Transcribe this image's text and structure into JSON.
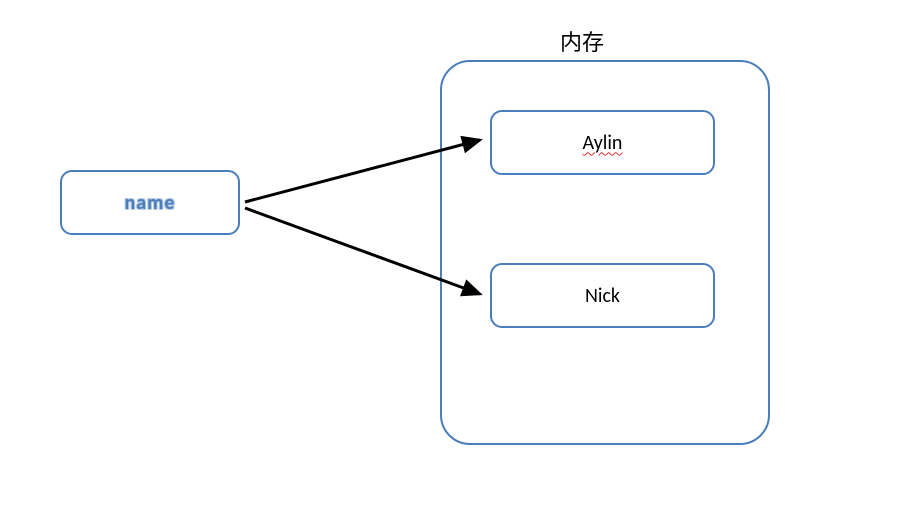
{
  "diagram": {
    "variable": {
      "label": "name"
    },
    "memory": {
      "title": "内存",
      "slots": [
        {
          "value": "Aylin",
          "spellError": true
        },
        {
          "value": "Nick",
          "spellError": false
        }
      ]
    },
    "colors": {
      "border": "#4a7ebb",
      "arrow": "#000000"
    }
  }
}
